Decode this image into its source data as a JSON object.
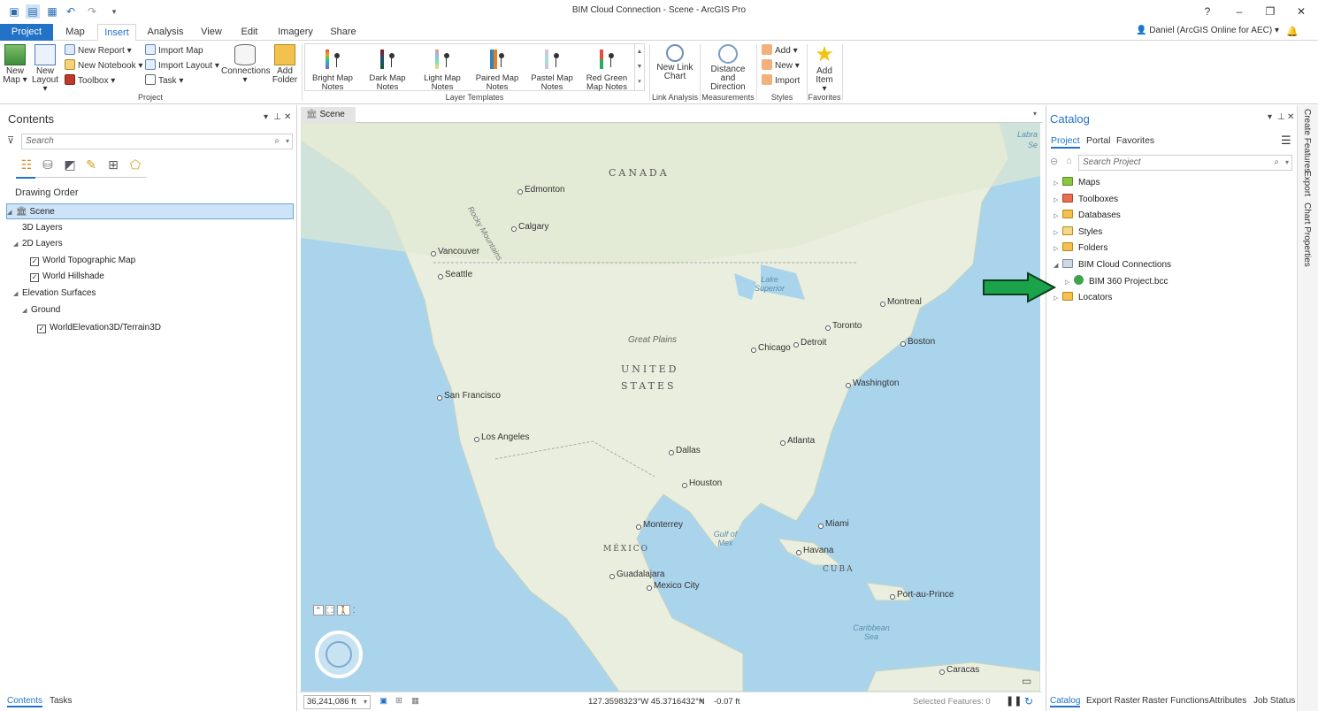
{
  "window": {
    "title": "BIM Cloud Connection - Scene - ArcGIS Pro",
    "help": "?",
    "user": "Daniel (ArcGIS Online for AEC)"
  },
  "tabs": [
    "Project",
    "Map",
    "Insert",
    "Analysis",
    "View",
    "Edit",
    "Imagery",
    "Share"
  ],
  "ribbon": {
    "project_group": {
      "new_map": "New Map",
      "new_layout": "New Layout",
      "new_report": "New Report",
      "new_notebook": "New Notebook",
      "toolbox": "Toolbox",
      "import_map": "Import Map",
      "import_layout": "Import Layout",
      "task": "Task",
      "connections": "Connections",
      "add_folder": "Add Folder",
      "label": "Project"
    },
    "layer_templates": {
      "items": [
        "Bright Map Notes",
        "Dark Map Notes",
        "Light Map Notes",
        "Paired Map Notes",
        "Pastel Map Notes",
        "Red Green Map Notes"
      ],
      "label": "Layer Templates"
    },
    "link_analysis": {
      "new_link_chart": "New Link Chart",
      "label": "Link Analysis"
    },
    "measurements": {
      "distance_direction": "Distance and Direction",
      "label": "Measurements"
    },
    "styles": {
      "add": "Add",
      "new": "New",
      "import": "Import",
      "label": "Styles"
    },
    "favorites": {
      "add_item": "Add Item",
      "label": "Favorites"
    }
  },
  "contents": {
    "title": "Contents",
    "search_placeholder": "Search",
    "heading": "Drawing Order",
    "items": {
      "scene": "Scene",
      "layers3d": "3D Layers",
      "layers2d": "2D Layers",
      "topo": "World Topographic Map",
      "hillshade": "World Hillshade",
      "elevation": "Elevation Surfaces",
      "ground": "Ground",
      "terrain": "WorldElevation3D/Terrain3D"
    },
    "bottom_tabs": [
      "Contents",
      "Tasks"
    ]
  },
  "map": {
    "tab": "Scene",
    "places": {
      "canada": "CANADA",
      "united": "UNITED",
      "states": "STATES",
      "mexico": "MÉXICO",
      "cuba": "CUBA",
      "great_plains": "Great Plains",
      "rocky": "Rocky Mountains",
      "labrador": "Labra",
      "sea": "Se",
      "lake_superior": "Lake Superior",
      "gulf": "Gulf of Mex",
      "caribbean": "Caribbean Sea"
    },
    "cities": {
      "edmonton": "Edmonton",
      "calgary": "Calgary",
      "vancouver": "Vancouver",
      "seattle": "Seattle",
      "san_francisco": "San Francisco",
      "los_angeles": "Los Angeles",
      "dallas": "Dallas",
      "houston": "Houston",
      "monterrey": "Monterrey",
      "guadalajara": "Guadalajara",
      "mexico_city": "Mexico City",
      "chicago": "Chicago",
      "detroit": "Detroit",
      "toronto": "Toronto",
      "montreal": "Montreal",
      "boston": "Boston",
      "washington": "Washington",
      "atlanta": "Atlanta",
      "miami": "Miami",
      "havana": "Havana",
      "port_au_prince": "Port-au-Prince",
      "caracas": "Caracas"
    },
    "status": {
      "scale": "36,241,086 ft",
      "coords": "127.3598323°W 45.3716432°N",
      "elevation": "-0.07 ft",
      "selected": "Selected Features: 0"
    }
  },
  "catalog": {
    "title": "Catalog",
    "tabs": [
      "Project",
      "Portal",
      "Favorites"
    ],
    "search_placeholder": "Search Project",
    "items": {
      "maps": "Maps",
      "toolboxes": "Toolboxes",
      "databases": "Databases",
      "styles": "Styles",
      "folders": "Folders",
      "bim": "BIM Cloud Connections",
      "bim360": "BIM 360 Project.bcc",
      "locators": "Locators"
    },
    "bottom_tabs": [
      "Catalog",
      "Export Raster",
      "Raster Functions",
      "Attributes",
      "Job Status"
    ]
  },
  "side_tabs": [
    "Create Features",
    "Export",
    "Chart Properties"
  ],
  "colors": {
    "accent": "#2272c8",
    "arrow": "#1aa34a",
    "water": "#aad4ec",
    "land": "#e9eedf"
  }
}
